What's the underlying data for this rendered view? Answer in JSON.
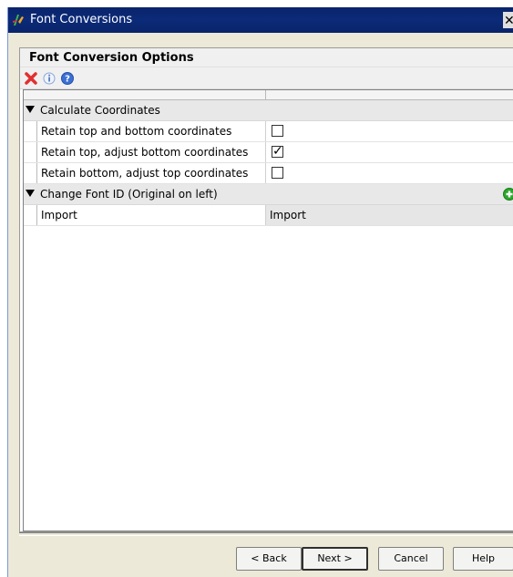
{
  "window": {
    "title": "Font Conversions",
    "close_glyph": "✕"
  },
  "panel": {
    "title": "Font Conversion Options"
  },
  "toolbar": {
    "icons": [
      "delete-icon",
      "info-icon",
      "help-icon"
    ]
  },
  "properties": {
    "categories": [
      {
        "label": "Calculate Coordinates",
        "items": [
          {
            "label": "Retain top and bottom coordinates",
            "checked": false
          },
          {
            "label": "Retain top, adjust bottom coordinates",
            "checked": true
          },
          {
            "label": "Retain bottom, adjust top coordinates",
            "checked": false
          }
        ]
      },
      {
        "label": "Change Font ID (Original on left)",
        "items": [
          {
            "label": "Import",
            "value": "Import"
          }
        ]
      }
    ]
  },
  "buttons": {
    "back": "< Back",
    "next": "Next >",
    "cancel": "Cancel",
    "help": "Help"
  },
  "colors": {
    "titlebar": "#0a246a",
    "window_bg": "#ece9d8",
    "delete_icon": "#e03030",
    "add_icon": "#2aa82a"
  }
}
